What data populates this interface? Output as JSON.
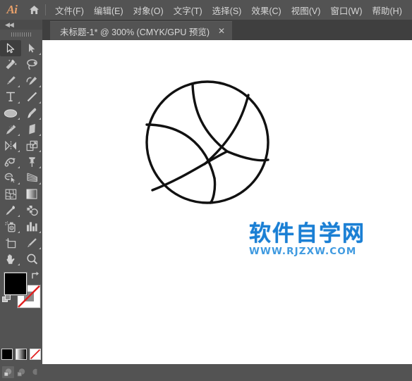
{
  "app": {
    "logo": "Ai",
    "home_icon": "home-icon"
  },
  "menubar": {
    "items": [
      {
        "label": "文件(F)",
        "name": "menu-file"
      },
      {
        "label": "编辑(E)",
        "name": "menu-edit"
      },
      {
        "label": "对象(O)",
        "name": "menu-object"
      },
      {
        "label": "文字(T)",
        "name": "menu-type"
      },
      {
        "label": "选择(S)",
        "name": "menu-select"
      },
      {
        "label": "效果(C)",
        "name": "menu-effect"
      },
      {
        "label": "视图(V)",
        "name": "menu-view"
      },
      {
        "label": "窗口(W)",
        "name": "menu-window"
      },
      {
        "label": "帮助(H)",
        "name": "menu-help"
      }
    ]
  },
  "tabs": {
    "active": {
      "title": "未标题-1* @ 300% (CMYK/GPU 预览)",
      "close": "✕"
    }
  },
  "toolbar": {
    "collapse": "◀◀",
    "tools": [
      {
        "name": "selection-tool",
        "icon": "arrow-solid-outline",
        "active": true,
        "flyout": false
      },
      {
        "name": "direct-selection-tool",
        "icon": "arrow-filled",
        "active": false,
        "flyout": true
      },
      {
        "name": "magic-wand-tool",
        "icon": "magic-wand",
        "active": false,
        "flyout": false
      },
      {
        "name": "lasso-tool",
        "icon": "lasso",
        "active": false,
        "flyout": false
      },
      {
        "name": "pen-tool",
        "icon": "pen",
        "active": false,
        "flyout": true
      },
      {
        "name": "curvature-tool",
        "icon": "curvature",
        "active": false,
        "flyout": true
      },
      {
        "name": "type-tool",
        "icon": "type-T",
        "active": false,
        "flyout": true
      },
      {
        "name": "line-segment-tool",
        "icon": "line-segment",
        "active": false,
        "flyout": true
      },
      {
        "name": "ellipse-tool",
        "icon": "ellipse",
        "active": false,
        "flyout": true
      },
      {
        "name": "paintbrush-tool",
        "icon": "paintbrush",
        "active": false,
        "flyout": true
      },
      {
        "name": "shaper-tool",
        "icon": "shaper-pencil",
        "active": false,
        "flyout": true
      },
      {
        "name": "eraser-tool",
        "icon": "eraser",
        "active": false,
        "flyout": true
      },
      {
        "name": "rotate-tool",
        "icon": "reflect",
        "active": false,
        "flyout": true
      },
      {
        "name": "scale-tool",
        "icon": "scale",
        "active": false,
        "flyout": true
      },
      {
        "name": "width-tool",
        "icon": "width-warp",
        "active": false,
        "flyout": true
      },
      {
        "name": "free-transform-tool",
        "icon": "pushpin",
        "active": false,
        "flyout": true
      },
      {
        "name": "shape-builder-tool",
        "icon": "shape-builder",
        "active": false,
        "flyout": true
      },
      {
        "name": "perspective-grid-tool",
        "icon": "perspective-grid",
        "active": false,
        "flyout": true
      },
      {
        "name": "mesh-tool",
        "icon": "mesh",
        "active": false,
        "flyout": false
      },
      {
        "name": "gradient-tool",
        "icon": "gradient",
        "active": false,
        "flyout": false
      },
      {
        "name": "eyedropper-tool",
        "icon": "eyedropper",
        "active": false,
        "flyout": true
      },
      {
        "name": "blend-tool",
        "icon": "blend",
        "active": false,
        "flyout": false
      },
      {
        "name": "symbol-sprayer-tool",
        "icon": "symbol-sprayer",
        "active": false,
        "flyout": true
      },
      {
        "name": "column-graph-tool",
        "icon": "bar-graph",
        "active": false,
        "flyout": true
      },
      {
        "name": "artboard-tool",
        "icon": "artboard",
        "active": false,
        "flyout": false
      },
      {
        "name": "slice-tool",
        "icon": "slice-knife",
        "active": false,
        "flyout": true
      },
      {
        "name": "hand-tool",
        "icon": "hand",
        "active": false,
        "flyout": true
      },
      {
        "name": "zoom-tool",
        "icon": "magnifier",
        "active": false,
        "flyout": false
      }
    ],
    "fill_color": "#000000",
    "stroke_color": "#ffffff",
    "swatches": [
      {
        "name": "color-swatch",
        "kind": "black"
      },
      {
        "name": "gradient-swatch",
        "kind": "grad"
      },
      {
        "name": "none-swatch",
        "kind": "none"
      }
    ],
    "draw_modes": [
      {
        "name": "draw-normal-mode",
        "active": true
      },
      {
        "name": "draw-behind-mode",
        "active": false
      },
      {
        "name": "draw-inside-mode",
        "active": false
      }
    ]
  },
  "canvas": {
    "artwork_name": "basketball-line-drawing",
    "stroke_color": "#111111",
    "background": "#ffffff"
  },
  "watermark": {
    "cn": "软件自学网",
    "url": "WWW.RJZXW.COM",
    "color": "#1a7fd4"
  }
}
